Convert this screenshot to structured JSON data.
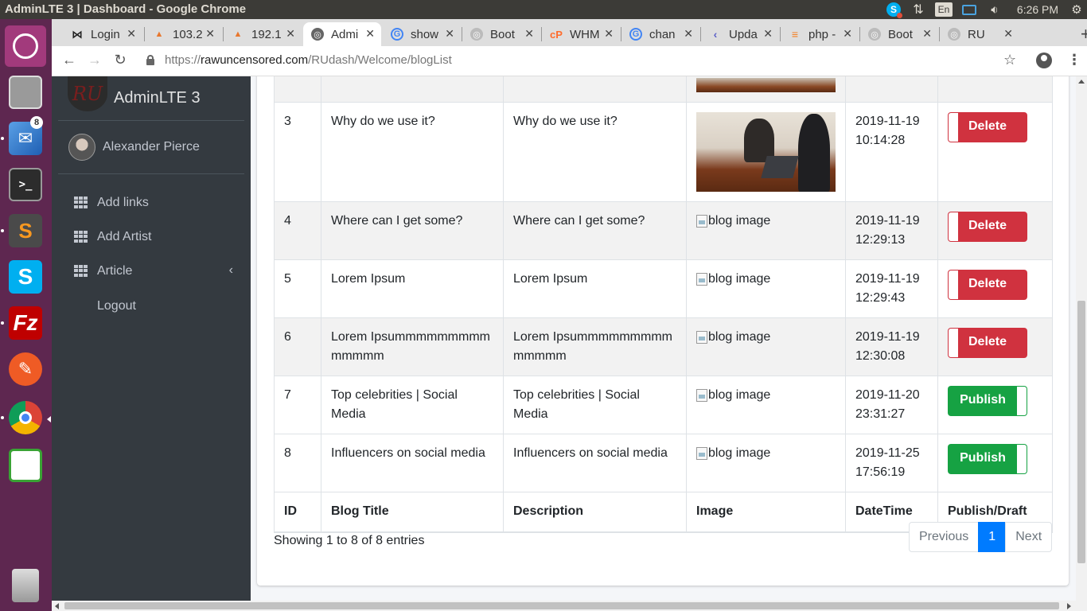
{
  "window": {
    "title": "AdminLTE 3 | Dashboard - Google Chrome"
  },
  "tray": {
    "lang": "En",
    "clock": "6:26 PM"
  },
  "launcher": {
    "thunderbird_badge": "8"
  },
  "tabs": [
    {
      "label": "Login",
      "icon": "bowtie-icon",
      "active": false
    },
    {
      "label": "103.2",
      "icon": "cpanel-icon",
      "active": false
    },
    {
      "label": "192.1",
      "icon": "cpanel-icon",
      "active": false
    },
    {
      "label": "Admi",
      "icon": "globe-icon",
      "active": true
    },
    {
      "label": "show",
      "icon": "google-icon",
      "active": false
    },
    {
      "label": "Boot",
      "icon": "globe-icon",
      "active": false
    },
    {
      "label": "WHM",
      "icon": "cpanel-icon",
      "active": false
    },
    {
      "label": "chan",
      "icon": "google-icon",
      "active": false
    },
    {
      "label": "Upda",
      "icon": "chevron-icon",
      "active": false
    },
    {
      "label": "php -",
      "icon": "stackoverflow-icon",
      "active": false
    },
    {
      "label": "Boot",
      "icon": "globe-icon",
      "active": false
    },
    {
      "label": "RU",
      "icon": "globe-icon",
      "active": false
    }
  ],
  "address": {
    "scheme": "https://",
    "domain": "rawuncensored.com",
    "path": "/RUdash/Welcome/blogList"
  },
  "sidebar": {
    "brand_logo": "RU",
    "brand": "AdminLTE 3",
    "user": "Alexander Pierce",
    "items": [
      {
        "label": "Add links",
        "icon": "grid-icon"
      },
      {
        "label": "Add Artist",
        "icon": "grid-icon"
      },
      {
        "label": "Article",
        "icon": "grid-icon",
        "chevron": "‹"
      },
      {
        "label": "Logout"
      }
    ]
  },
  "table": {
    "headers": [
      "ID",
      "Blog Title",
      "Description",
      "Image",
      "DateTime",
      "Publish/Draft"
    ],
    "rows": [
      {
        "id": "3",
        "title": "Why do we use it?",
        "description": "Why do we use it?",
        "image": "photo",
        "date": "2019-11-19",
        "time": "10:14:28",
        "action": "Delete"
      },
      {
        "id": "4",
        "title": "Where can I get some?",
        "description": "Where can I get some?",
        "image": "blog image",
        "date": "2019-11-19",
        "time": "12:29:13",
        "action": "Delete"
      },
      {
        "id": "5",
        "title": "Lorem Ipsum",
        "description": "Lorem Ipsum",
        "image": "blog image",
        "date": "2019-11-19",
        "time": "12:29:43",
        "action": "Delete"
      },
      {
        "id": "6",
        "title": "Lorem Ipsummmmmmmmmmmmmm",
        "description": "Lorem Ipsummmmmmmmmmmmmm",
        "image": "blog image",
        "date": "2019-11-19",
        "time": "12:30:08",
        "action": "Delete"
      },
      {
        "id": "7",
        "title": "Top celebrities | Social Media",
        "description": "Top celebrities | Social Media",
        "image": "blog image",
        "date": "2019-11-20",
        "time": "23:31:27",
        "action": "Publish"
      },
      {
        "id": "8",
        "title": "Influencers on social media",
        "description": "Influencers on social media",
        "image": "blog image",
        "date": "2019-11-25",
        "time": "17:56:19",
        "action": "Publish"
      }
    ]
  },
  "footer": {
    "info": "Showing 1 to 8 of 8 entries",
    "prev": "Previous",
    "page": "1",
    "next": "Next"
  },
  "colors": {
    "sidebar_bg": "#343a40",
    "delete": "#d0323f",
    "publish": "#16a243",
    "page_active": "#007bff",
    "launcher_bg": "#5e2750"
  }
}
